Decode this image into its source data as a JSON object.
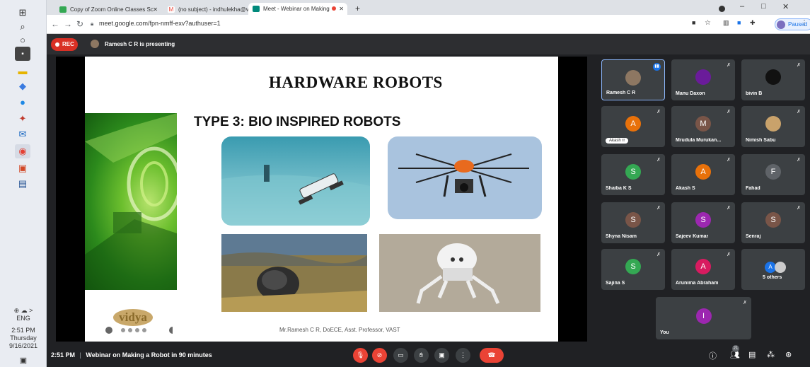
{
  "taskbar": {
    "lang": "ENG",
    "time": "2:51 PM",
    "day": "Thursday",
    "date": "9/16/2021",
    "tray": "⊕ ☁ >"
  },
  "browser": {
    "tabs": [
      {
        "label": "Copy of Zoom Online Classes Sc"
      },
      {
        "label": "(no subject) - indhulekha@vidya"
      },
      {
        "label": "Meet - Webinar on Making"
      }
    ],
    "url": "meet.google.com/fpn-nmff-exv?authuser=1",
    "profile_label": "Paused"
  },
  "meet": {
    "rec_label": "REC",
    "presenting_label": "Ramesh C R is presenting"
  },
  "slide": {
    "title": "HARDWARE ROBOTS",
    "subtitle": "TYPE 3: BIO INSPIRED ROBOTS",
    "footer": "Mr.Ramesh C R, DoECE, Asst. Professor, VAST",
    "logo_text": "vidya"
  },
  "participants": [
    {
      "name": "Ramesh C R",
      "initial": "",
      "color": "#8d7762",
      "self_speaking": true
    },
    {
      "name": "Manu Daxon",
      "initial": "",
      "color": "#6a1b9a"
    },
    {
      "name": "bivin B",
      "initial": "",
      "color": "#111111"
    },
    {
      "name": "",
      "chip": "Akash rr",
      "initial": "A",
      "color": "#e8710a"
    },
    {
      "name": "Mrudula Murukan...",
      "initial": "M",
      "color": "#795548"
    },
    {
      "name": "Nimish Sabu",
      "initial": "",
      "color": "#c9a26b"
    },
    {
      "name": "Shaiba K S",
      "initial": "S",
      "color": "#34a853"
    },
    {
      "name": "Akash S",
      "initial": "A",
      "color": "#e8710a"
    },
    {
      "name": "Fahad",
      "initial": "F",
      "color": "#5f6368"
    },
    {
      "name": "Shyna Nisam",
      "initial": "S",
      "color": "#795548"
    },
    {
      "name": "Sajeev Kumar",
      "initial": "S",
      "color": "#9c27b0"
    },
    {
      "name": "Senraj",
      "initial": "S",
      "color": "#795548"
    },
    {
      "name": "Sajina S",
      "initial": "S",
      "color": "#34a853"
    },
    {
      "name": "Arunima Abraham",
      "initial": "A",
      "color": "#d81b60"
    },
    {
      "name": "5 others",
      "initial": "A",
      "color": "#1a73e8"
    },
    {
      "name": "You",
      "initial": "I",
      "color": "#9c27b0"
    }
  ],
  "bottom": {
    "time": "2:51 PM",
    "separator": "|",
    "meeting_title": "Webinar on Making a Robot in 90 minutes",
    "people_count": "21"
  }
}
